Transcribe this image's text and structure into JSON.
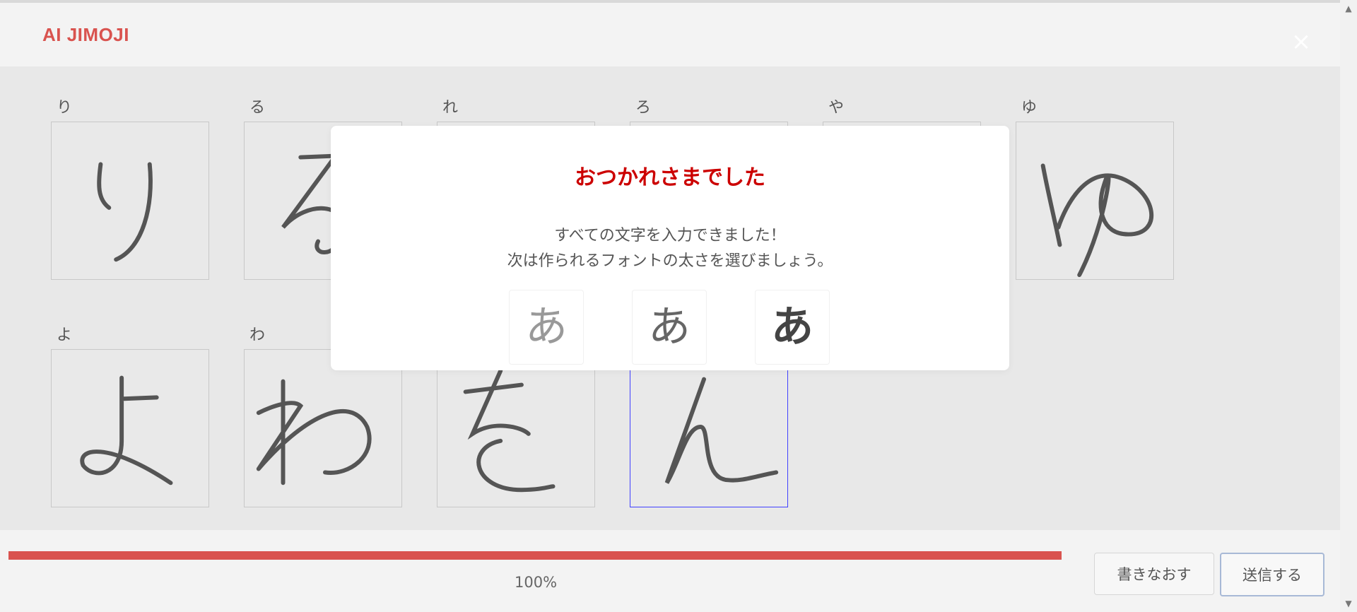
{
  "app": {
    "title": "AI JIMOJI",
    "close_symbol": "×"
  },
  "grid": {
    "cells": [
      {
        "label": "り"
      },
      {
        "label": "る"
      },
      {
        "label": "れ"
      },
      {
        "label": "ろ"
      },
      {
        "label": "や"
      },
      {
        "label": "ゆ"
      },
      {
        "label": "よ"
      },
      {
        "label": "わ"
      },
      {
        "label": ""
      },
      {
        "label": ""
      }
    ],
    "active_index": 9
  },
  "modal": {
    "title": "おつかれさまでした",
    "message_line1": "すべての文字を入力できました！",
    "message_line2": "次は作られるフォントの太さを選びましょう。",
    "weight_options": [
      {
        "glyph": "あ",
        "weight": "thin"
      },
      {
        "glyph": "あ",
        "weight": "regular"
      },
      {
        "glyph": "あ",
        "weight": "bold"
      }
    ]
  },
  "footer": {
    "progress_percent": 100,
    "progress_text": "100%",
    "rewrite_label": "書きなおす",
    "send_label": "送信する"
  },
  "colors": {
    "accent": "#d9534f",
    "modal_title": "#cc0000"
  }
}
